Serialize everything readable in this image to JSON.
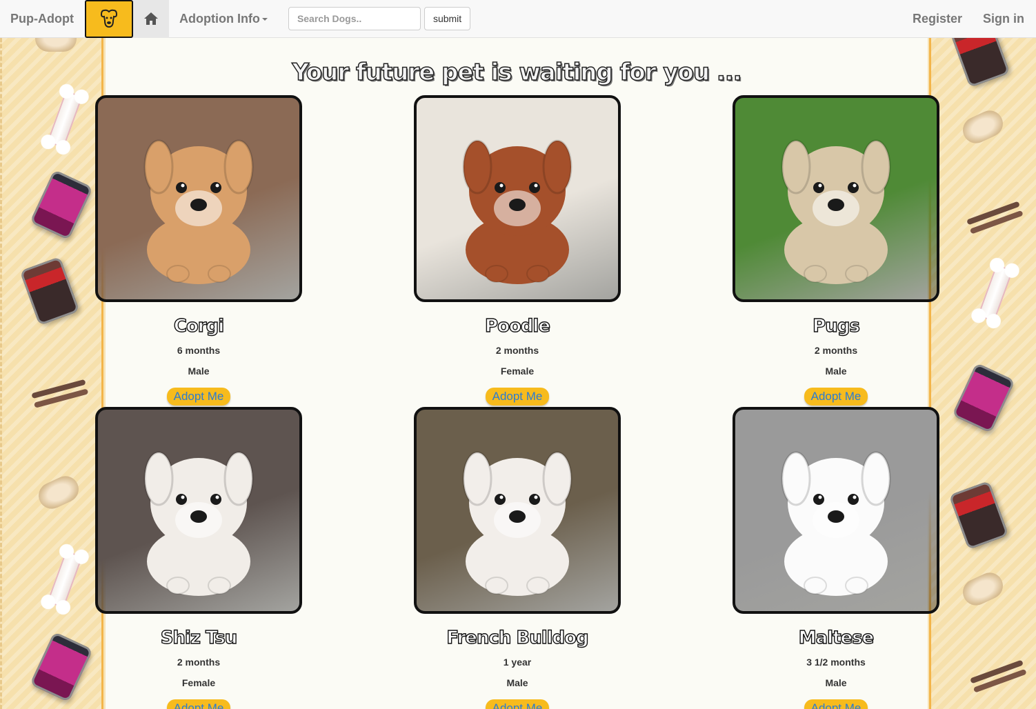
{
  "navbar": {
    "brand": "Pup-Adopt",
    "logo_icon": "dog-face-icon",
    "home_icon": "home-icon",
    "adoption_info": "Adoption Info",
    "search_placeholder": "Search Dogs..",
    "submit_label": "submit",
    "register": "Register",
    "sign_in": "Sign in"
  },
  "headline": "Your future pet is waiting for you ...",
  "adopt_label": "Adopt Me",
  "dogs": [
    {
      "name": "Corgi",
      "age": "6 months",
      "sex": "Male",
      "fur": "#d9a06a",
      "bg": "#8b6a55"
    },
    {
      "name": "Poodle",
      "age": "2 months",
      "sex": "Female",
      "fur": "#a5502b",
      "bg": "#e9e4dc"
    },
    {
      "name": "Pugs",
      "age": "2 months",
      "sex": "Male",
      "fur": "#d8c7a8",
      "bg": "#4f8a36"
    },
    {
      "name": "Shiz Tsu",
      "age": "2 months",
      "sex": "Female",
      "fur": "#f1ede8",
      "bg": "#5e5450"
    },
    {
      "name": "French Bulldog",
      "age": "1 year",
      "sex": "Male",
      "fur": "#f2eeea",
      "bg": "#6b5f4c"
    },
    {
      "name": "Maltese",
      "age": "3 1/2 months",
      "sex": "Male",
      "fur": "#fbfbfb",
      "bg": "#9a9a9a"
    }
  ]
}
